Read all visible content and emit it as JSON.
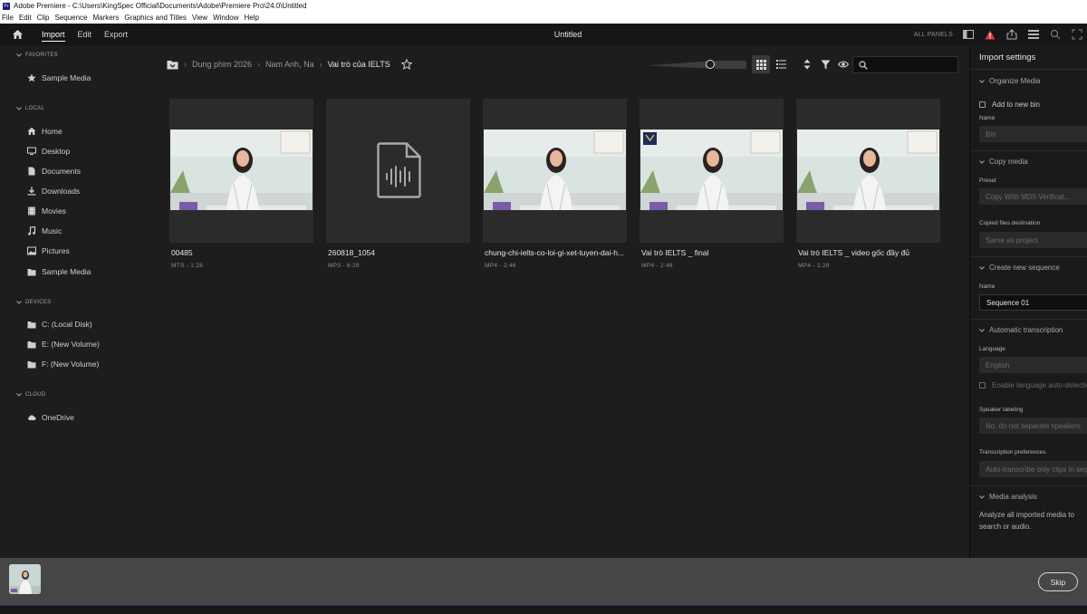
{
  "window": {
    "title": "Adobe Premiere - C:\\Users\\KingSpec Official\\Documents\\Adobe\\Premiere Pro\\24.0\\Untitled",
    "logo_text": "Pr"
  },
  "menu": [
    "File",
    "Edit",
    "Clip",
    "Sequence",
    "Markers",
    "Graphics and Titles",
    "View",
    "Window",
    "Help"
  ],
  "header": {
    "tabs": [
      {
        "label": "Import",
        "active": true
      },
      {
        "label": "Edit",
        "active": false
      },
      {
        "label": "Export",
        "active": false
      }
    ],
    "doc_title": "Untitled",
    "all_panels": "ALL PANELS"
  },
  "sidebar": {
    "favorites": {
      "heading": "FAVORITES",
      "items": [
        {
          "label": "Sample Media",
          "icon": "star-icon"
        }
      ]
    },
    "local": {
      "heading": "LOCAL",
      "items": [
        {
          "label": "Home",
          "icon": "home-icon"
        },
        {
          "label": "Desktop",
          "icon": "desktop-icon"
        },
        {
          "label": "Documents",
          "icon": "document-icon"
        },
        {
          "label": "Downloads",
          "icon": "download-icon"
        },
        {
          "label": "Movies",
          "icon": "film-icon"
        },
        {
          "label": "Music",
          "icon": "music-icon"
        },
        {
          "label": "Pictures",
          "icon": "picture-icon"
        },
        {
          "label": "Sample Media",
          "icon": "folder-icon"
        }
      ]
    },
    "devices": {
      "heading": "DEVICES",
      "items": [
        {
          "label": "C: (Local Disk)",
          "icon": "folder-icon"
        },
        {
          "label": "E: (New Volume)",
          "icon": "folder-icon"
        },
        {
          "label": "F: (New Volume)",
          "icon": "folder-icon"
        }
      ]
    },
    "cloud": {
      "heading": "CLOUD",
      "items": [
        {
          "label": "OneDrive",
          "icon": "cloud-icon"
        }
      ]
    }
  },
  "breadcrumb": {
    "items": [
      "Dung phim 2026",
      "Nam Anh, Na"
    ],
    "current": "Vai trò của IELTS"
  },
  "search": {
    "placeholder": ""
  },
  "media": [
    {
      "name": "00485",
      "meta": "MTS - 1:28",
      "kind": "video"
    },
    {
      "name": "260818_1054",
      "meta": "MP3 - 6:29",
      "kind": "audio"
    },
    {
      "name": "chung-chi-ielts-co-loi-gi-xet-tuyen-dai-h...",
      "meta": "MP4 - 2:46",
      "kind": "video"
    },
    {
      "name": "Vai trò IELTS _ final",
      "meta": "MP4 - 2:46",
      "kind": "video-logo"
    },
    {
      "name": "Vai trò IELTS _ video gốc đầy đủ",
      "meta": "MP4 - 1:28",
      "kind": "video"
    }
  ],
  "import_settings": {
    "title": "Import settings",
    "organize": {
      "heading": "Organize Media",
      "add_to_bin": "Add to new bin",
      "name_label": "Name",
      "name_placeholder": "Bin"
    },
    "copy": {
      "heading": "Copy media",
      "preset_label": "Preset",
      "preset_value": "Copy With MD5 Verificat...",
      "dest_label": "Copied files destination",
      "dest_value": "Same as project"
    },
    "sequence": {
      "heading": "Create new sequence",
      "name_label": "Name",
      "name_value": "Sequence 01"
    },
    "transcription": {
      "heading": "Automatic transcription",
      "language_label": "Language",
      "language_value": "English",
      "auto_detect": "Enable language auto-detection",
      "speaker_label": "Speaker labeling",
      "speaker_value": "No, do not separate speakers",
      "prefs_label": "Transcription preferences",
      "prefs_value": "Auto-transcribe only clips in sequence"
    },
    "analysis": {
      "heading": "Media analysis",
      "text": "Analyze all imported media to search or audio."
    }
  },
  "bottom": {
    "skip": "Skip"
  },
  "colors": {
    "accent": "#ffffff",
    "warning": "#e03a3a",
    "bg": "#1d1d1d"
  }
}
